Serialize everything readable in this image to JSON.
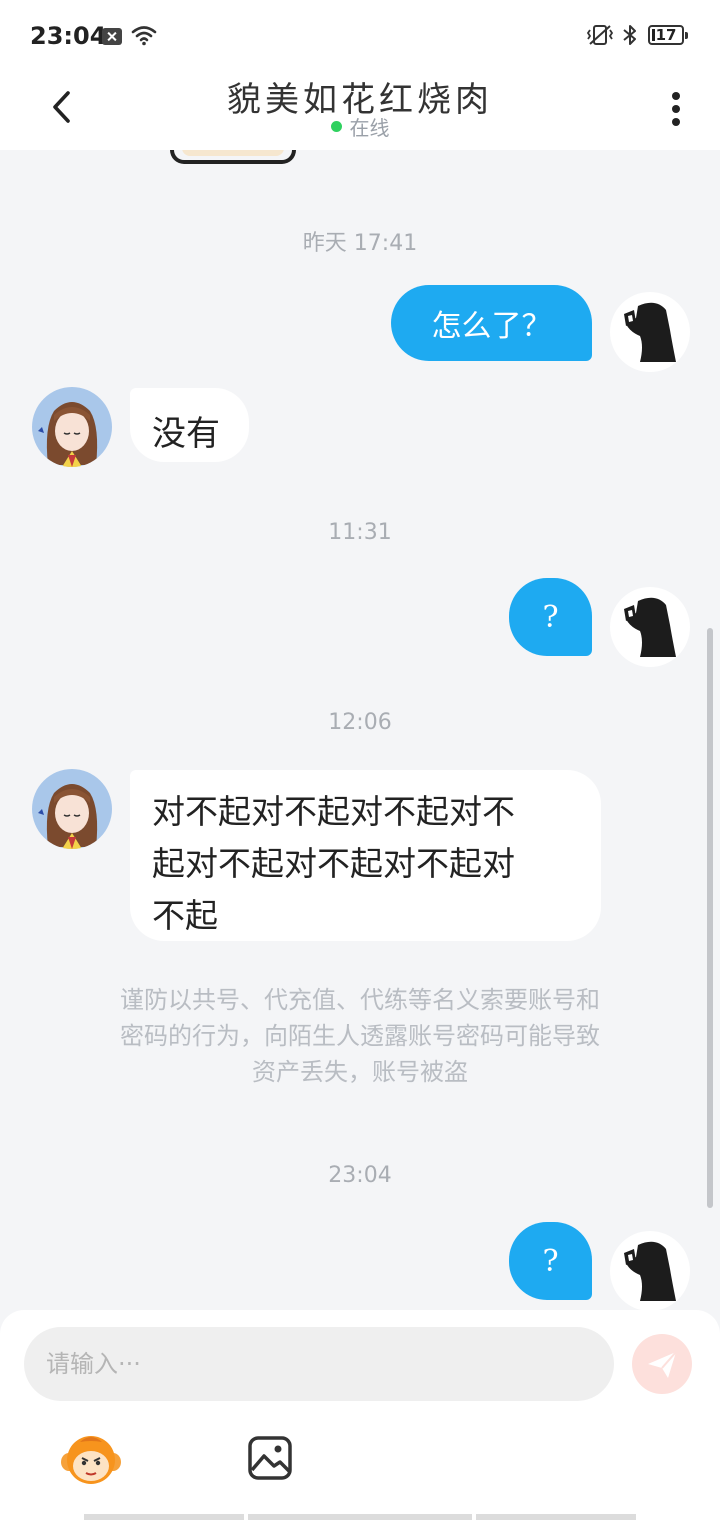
{
  "status_bar": {
    "time": "23:04",
    "battery_level": "17",
    "icons": [
      "notification-x-icon",
      "wifi-icon",
      "vibrate-icon",
      "bluetooth-icon",
      "battery-icon"
    ]
  },
  "header": {
    "title": "貌美如花红烧肉",
    "online_label": "在线"
  },
  "messages": {
    "ts1": "昨天 17:41",
    "m1": "怎么了？",
    "m2": "没有",
    "ts2": "11:31",
    "m3": "?",
    "ts3": "12:06",
    "m4_line1": "对不起对不起对不起对不",
    "m4_line2": "起对不起对不起对不起对",
    "m4_line3": "不起",
    "warning_line1": "谨防以共号、代充值、代练等名义索要账号和",
    "warning_line2": "密码的行为，向陌生人透露账号密码可能导致",
    "warning_line3": "资产丢失，账号被盗",
    "ts4": "23:04",
    "m5": "?"
  },
  "input": {
    "placeholder": "请输入···"
  },
  "colors": {
    "outgoing_bubble": "#1eaaf1",
    "online_dot": "#2fd15f",
    "send_button": "#fde0dc"
  }
}
